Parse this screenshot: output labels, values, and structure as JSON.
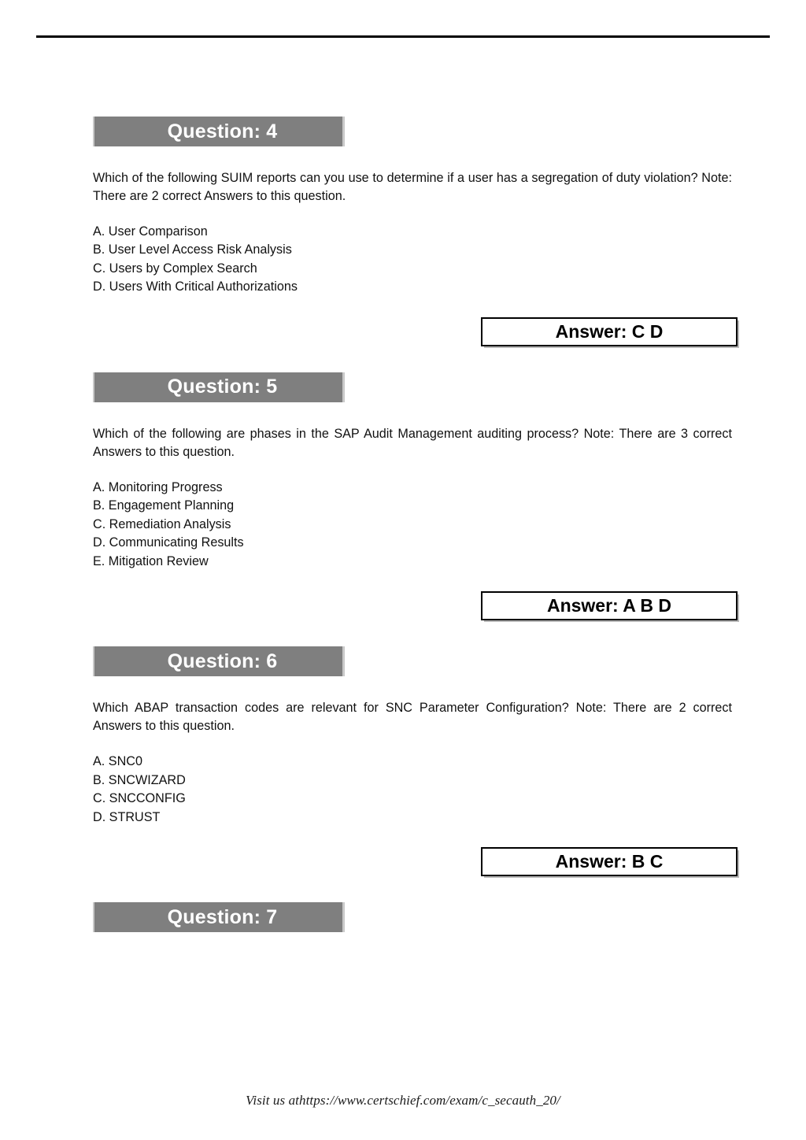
{
  "document": {
    "questions": [
      {
        "header": "Question: 4",
        "body": "Which of the following SUIM reports can you use to determine if a user has a segregation of duty violation? Note: There are 2 correct Answers to this question.",
        "options": [
          "A. User Comparison",
          "B. User Level Access Risk Analysis",
          "C. Users by Complex Search",
          "D. Users With Critical Authorizations"
        ],
        "answer": "Answer: C D"
      },
      {
        "header": "Question: 5",
        "body": "Which of the following are phases in the SAP Audit Management auditing process? Note: There are 3 correct Answers to this question.",
        "options": [
          "A. Monitoring Progress",
          "B. Engagement Planning",
          "C. Remediation Analysis",
          "D. Communicating Results",
          "E. Mitigation Review"
        ],
        "answer": "Answer: A B D"
      },
      {
        "header": "Question: 6",
        "body": "Which ABAP transaction codes are relevant for SNC Parameter Configuration? Note: There are 2 correct Answers to this question.",
        "options": [
          "A. SNC0",
          "B. SNCWIZARD",
          "C. SNCCONFIG",
          "D. STRUST"
        ],
        "answer": "Answer: B C"
      },
      {
        "header": "Question: 7",
        "body": "",
        "options": [],
        "answer": ""
      }
    ],
    "footer": "Visit us athttps://www.certschief.com/exam/c_secauth_20/",
    "colors": {
      "header_bar": "#7f7f7f",
      "header_text": "#ffffff",
      "body_text": "#111111",
      "rule": "#000000",
      "answer_border": "#000000"
    }
  }
}
